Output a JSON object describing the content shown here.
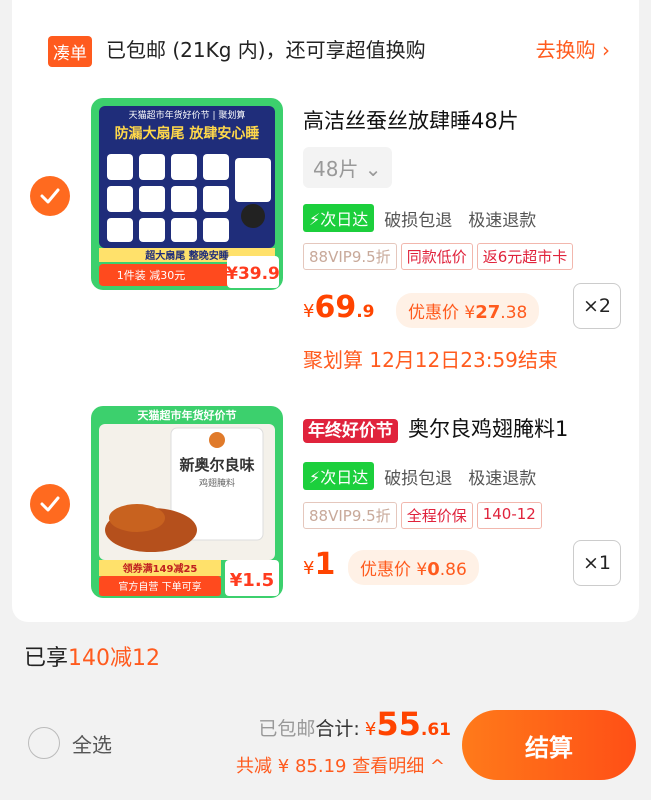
{
  "bundle": {
    "tag": "凑单",
    "text": "已包邮 (21Kg 内)，还可享超值换购",
    "link": "去换购 ›"
  },
  "items": [
    {
      "title": "高洁丝蚕丝放肆睡48片",
      "variant": "48片 ⌄",
      "next_day": "⚡次日达",
      "feature1": "破损包退",
      "feature2": "极速退款",
      "tags": [
        "88VIP9.5折",
        "同款低价",
        "返6元超市卡"
      ],
      "price_currency": "¥",
      "price_int": "69",
      "price_dec": ".9",
      "promo_label": "优惠价",
      "promo_currency": "¥",
      "promo_int": "27",
      "promo_dec": ".38",
      "qty": "×2",
      "deadline": "聚划算 12月12日23:59结束",
      "thumb": {
        "banner": "天猫超市年货好价节 | 聚划算",
        "headline": "防漏大扇尾  放肆安心睡",
        "footer": "超大扇尾 整晚安睡",
        "deal": "1件装 减30元",
        "price": "¥39.9"
      }
    },
    {
      "badge": "年终好价节",
      "title": "奥尔良鸡翅腌料1",
      "next_day": "⚡次日达",
      "feature1": "破损包退",
      "feature2": "极速退款",
      "tags": [
        "88VIP9.5折",
        "全程价保",
        "140-12"
      ],
      "price_currency": "¥",
      "price_int": "1",
      "promo_label": "优惠价",
      "promo_currency": "¥",
      "promo_int": "0",
      "promo_dec": ".86",
      "qty": "×1",
      "thumb": {
        "banner": "天猫超市年货好价节",
        "headline": "新奥尔良味",
        "sub": "鸡翅腌料",
        "coupon": "领券满149减25",
        "footer": "官方自营 下单可享",
        "price": "¥1.5"
      }
    }
  ],
  "summary": {
    "discount_prefix": "已享",
    "discount_value": "140减12",
    "select_all": "全选",
    "shipping": "已包邮",
    "total_label": "合计:",
    "total_currency": "¥",
    "total_int": "55",
    "total_dec": ".61",
    "savings": "共减 ¥ 85.19  查看明细 ^",
    "checkout": "结算"
  },
  "colors": {
    "accent": "#ff5b1e",
    "price": "#ff4400",
    "next_day": "#1ccf3c"
  }
}
